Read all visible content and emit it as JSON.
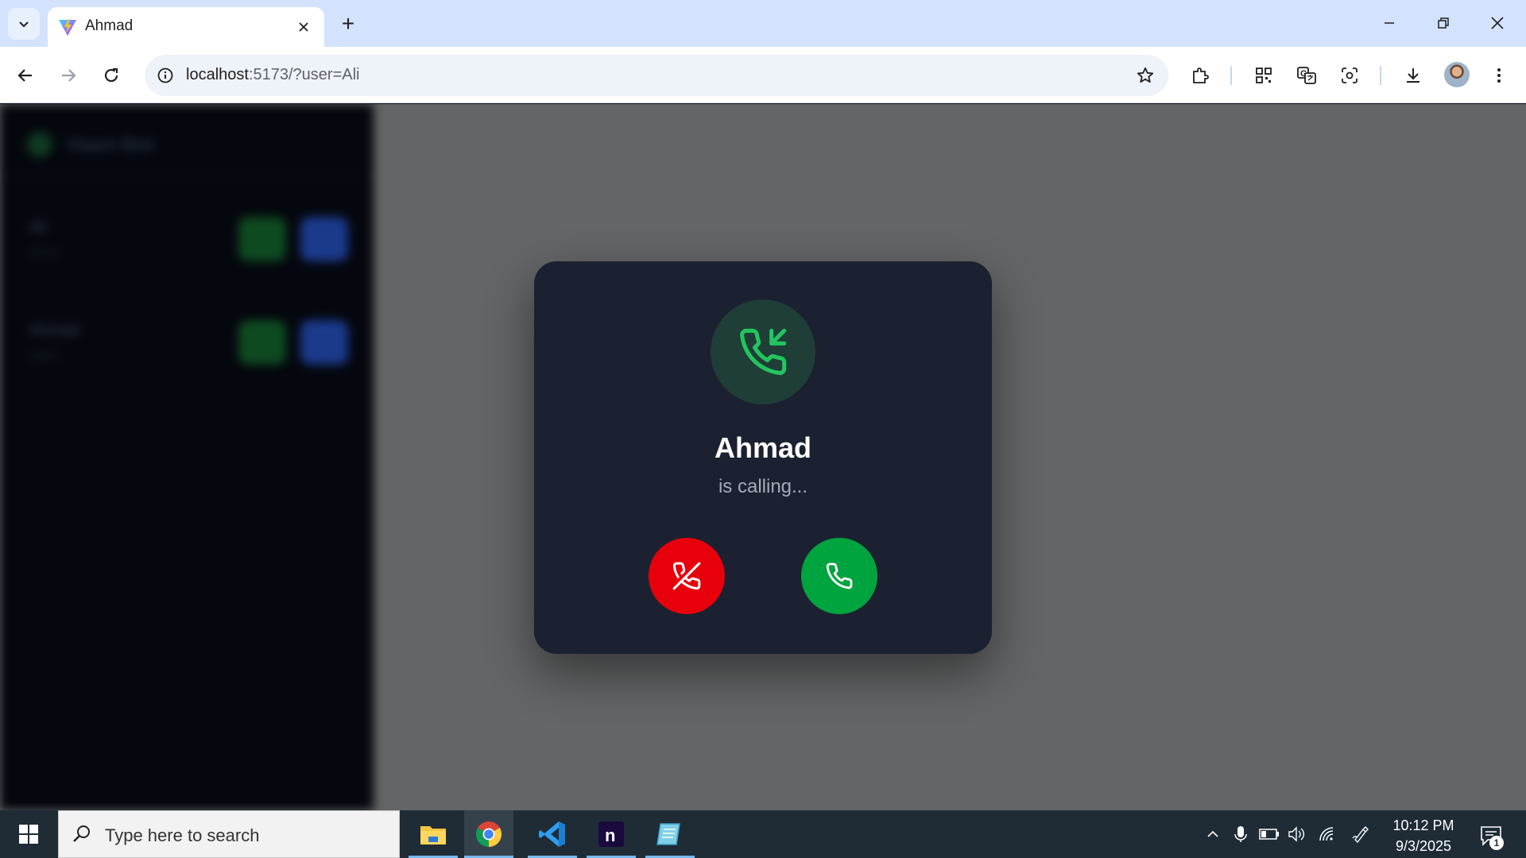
{
  "browser": {
    "tab_title": "Ahmad",
    "url_host": "localhost",
    "url_rest": ":5173/?user=Ali",
    "new_tab_symbol": "+"
  },
  "sidebar": {
    "title": "Vaani Bot",
    "users": [
      {
        "name": "Ali",
        "status": "online"
      },
      {
        "name": "Ahmad",
        "status": "online"
      }
    ]
  },
  "incoming_call": {
    "caller_name": "Ahmad",
    "status_text": "is calling...",
    "icons": {
      "header": "phone-incoming-icon",
      "decline": "phone-off-icon",
      "accept": "phone-icon"
    },
    "colors": {
      "decline": "#e7000b",
      "accept": "#00a43e",
      "icon_accent": "#22c55e",
      "card": "#1b2130"
    }
  },
  "taskbar": {
    "search_placeholder": "Type here to search",
    "apps": [
      "file-explorer",
      "chrome",
      "vscode",
      "notion",
      "notepad"
    ],
    "time": "10:12 PM",
    "date": "9/3/2025",
    "notification_count": "1"
  }
}
